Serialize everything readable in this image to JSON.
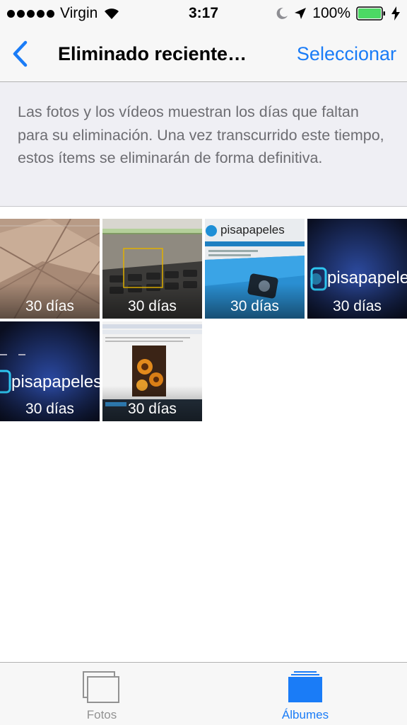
{
  "status_bar": {
    "carrier": "Virgin",
    "time": "3:17",
    "battery_percent": "100%",
    "battery_level": 1.0,
    "signal_bars": 5
  },
  "nav": {
    "title": "Eliminado reciente…",
    "select_label": "Seleccionar"
  },
  "info": {
    "text": "Las fotos y los vídeos muestran los días que faltan para su eliminación. Una vez transcurrido este tiempo, estos ítems se eliminarán de forma definitiva."
  },
  "photos": [
    {
      "days": "30 días"
    },
    {
      "days": "30 días"
    },
    {
      "days": "30 días",
      "caption": "pisapapeles"
    },
    {
      "days": "30 días",
      "caption": "pisapapeles"
    },
    {
      "days": "30 días",
      "caption": "pisapapeles"
    },
    {
      "days": "30 días"
    }
  ],
  "tabs": [
    {
      "label": "Fotos",
      "active": false
    },
    {
      "label": "Álbumes",
      "active": true
    }
  ],
  "colors": {
    "accent": "#1a7cf7",
    "inactive": "#929292",
    "battery": "#4cd964"
  }
}
